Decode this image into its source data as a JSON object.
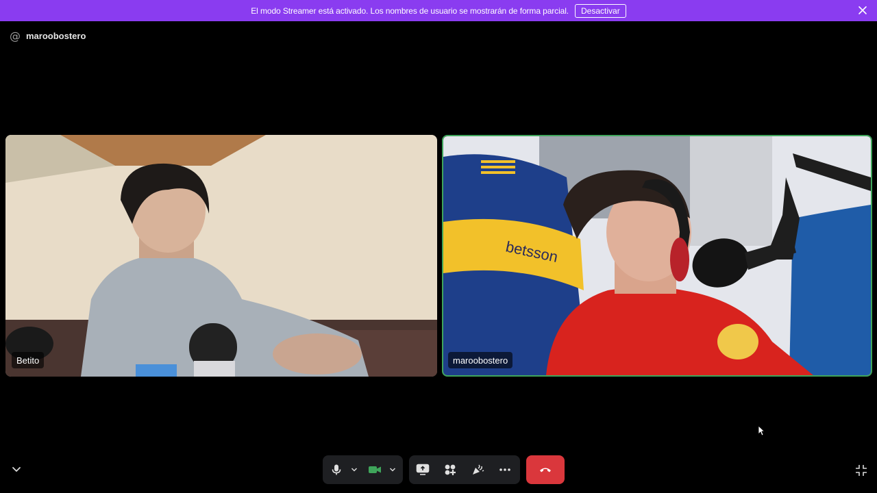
{
  "banner": {
    "text": "El modo Streamer está activado. Los nombres de usuario se mostrarán de forma parcial.",
    "button_label": "Desactivar",
    "icons": {
      "close": "close-icon"
    }
  },
  "channel": {
    "icon": "at-icon",
    "name": "maroobostero"
  },
  "participants": [
    {
      "name": "Betito",
      "speaking": false
    },
    {
      "name": "maroobostero",
      "speaking": true
    }
  ],
  "controls": {
    "icons": [
      "microphone-icon",
      "chevron-down-icon",
      "camera-icon",
      "chevron-down-icon",
      "screen-share-icon",
      "activities-icon",
      "soundboard-icon",
      "more-icon",
      "hang-up-icon",
      "collapse-icon",
      "exit-fullscreen-icon"
    ]
  },
  "colors": {
    "banner": "#8a3cf0",
    "speaking_border": "#3fa55b",
    "camera_active": "#3fa55b",
    "hang_up": "#da373c",
    "control_bar": "#1e1f22"
  }
}
